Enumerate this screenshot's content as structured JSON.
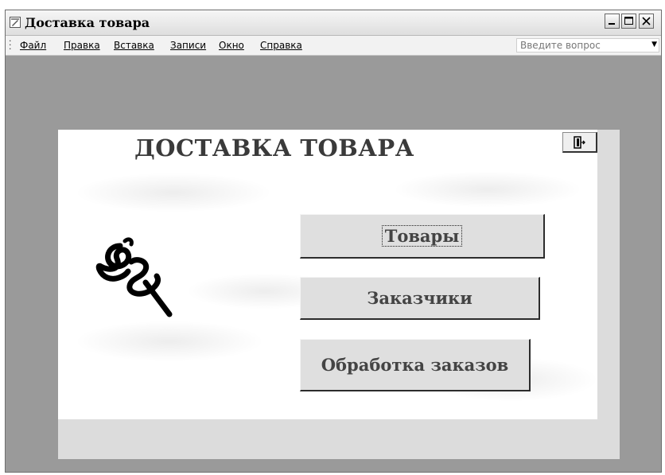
{
  "window": {
    "title": "Доставка товара"
  },
  "menu": {
    "items": [
      "Файл",
      "Правка",
      "Вставка",
      "Записи",
      "Окно",
      "Справка"
    ],
    "ask_placeholder": "Введите вопрос"
  },
  "form": {
    "title": "ДОСТАВКА ТОВАРА",
    "buttons": {
      "goods": "Товары",
      "customers": "Заказчики",
      "orders": "Обработка заказов"
    }
  },
  "icons": {
    "app": "access-form-icon",
    "exit": "exit-door-icon",
    "logo": "handwritten-logo"
  }
}
